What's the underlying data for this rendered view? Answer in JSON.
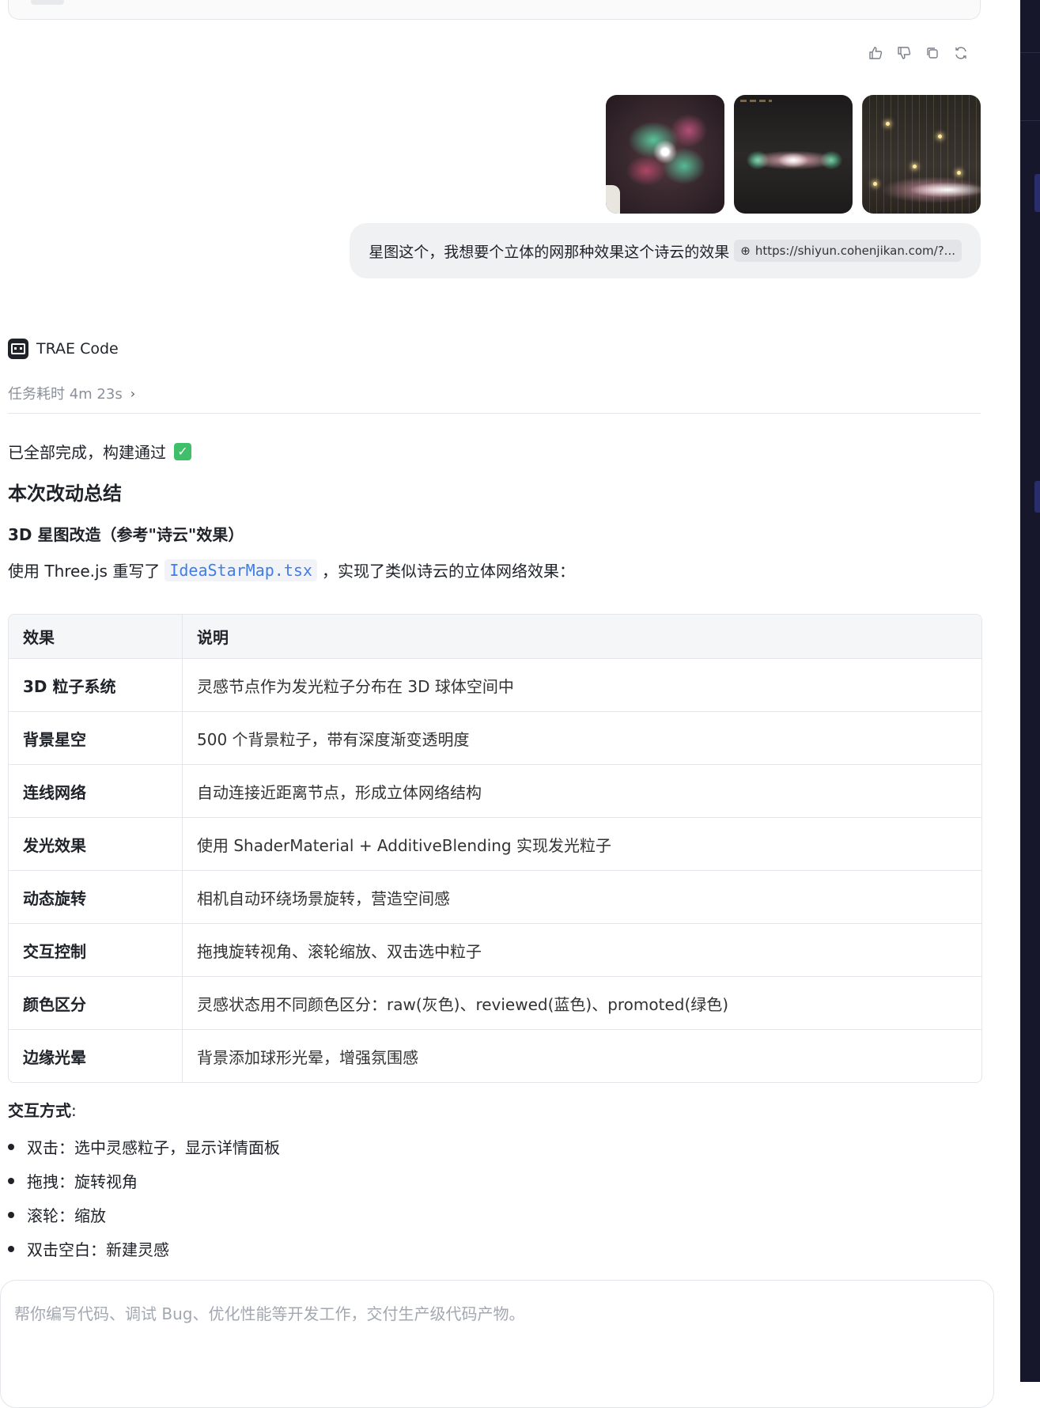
{
  "message": {
    "text": "星图这个，我想要个立体的网那种效果这个诗云的效果",
    "link": "https://shiyun.cohenjikan.com/?..."
  },
  "agent": {
    "name": "TRAE Code",
    "timing": "任务耗时 4m 23s"
  },
  "response": {
    "done": "已全部完成，构建通过",
    "summary_title": "本次改动总结",
    "subtitle": "3D 星图改造（参考\"诗云\"效果）",
    "intro_before": "使用 Three.js 重写了",
    "intro_code": "IdeaStarMap.tsx",
    "intro_after": "，实现了类似诗云的立体网络效果：",
    "table": {
      "headers": [
        "效果",
        "说明"
      ],
      "rows": [
        [
          "3D 粒子系统",
          "灵感节点作为发光粒子分布在 3D 球体空间中"
        ],
        [
          "背景星空",
          "500 个背景粒子，带有深度渐变透明度"
        ],
        [
          "连线网络",
          "自动连接近距离节点，形成立体网络结构"
        ],
        [
          "发光效果",
          "使用 ShaderMaterial + AdditiveBlending 实现发光粒子"
        ],
        [
          "动态旋转",
          "相机自动环绕场景旋转，营造空间感"
        ],
        [
          "交互控制",
          "拖拽旋转视角、滚轮缩放、双击选中粒子"
        ],
        [
          "颜色区分",
          "灵感状态用不同颜色区分：raw(灰色)、reviewed(蓝色)、promoted(绿色)"
        ],
        [
          "边缘光晕",
          "背景添加球形光晕，增强氛围感"
        ]
      ]
    },
    "interact_title": "交互方式",
    "interact_colon": ":",
    "bullets": [
      "双击：选中灵感粒子，显示详情面板",
      "拖拽：旋转视角",
      "滚轮：缩放",
      "双击空白：新建灵感"
    ]
  },
  "composer": {
    "placeholder": "帮你编写代码、调试 Bug、优化性能等开发工作，交付生产级代码产物。"
  },
  "icons": [
    "thumbs-up-icon",
    "thumbs-down-icon",
    "copy-icon",
    "refresh-icon",
    "globe-icon",
    "check-icon"
  ],
  "colors": {
    "link": "#3f7de8",
    "check": "#3fbf6a",
    "panel": "#17172b"
  }
}
